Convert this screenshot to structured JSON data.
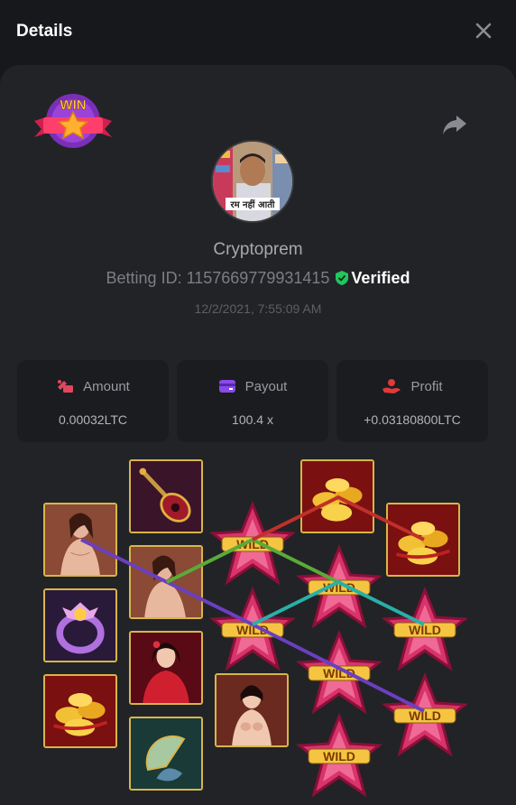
{
  "header": {
    "title": "Details"
  },
  "badge": {
    "text": "WIN"
  },
  "avatar": {
    "caption": "रम नहीं आती"
  },
  "user": {
    "name": "Cryptoprem",
    "betting_prefix": "Betting ID: 1157669779931415",
    "verified_label": "Verified",
    "timestamp": "12/2/2021, 7:55:09 AM"
  },
  "stats": [
    {
      "label": "Amount",
      "value": "0.00032LTC",
      "icon": "amount-icon"
    },
    {
      "label": "Payout",
      "value": "100.4 x",
      "icon": "wallet-icon"
    },
    {
      "label": "Profit",
      "value": "+0.03180800LTC",
      "icon": "profit-icon"
    }
  ],
  "reels": {
    "wild_text": "WILD",
    "symbols": [
      "lady",
      "pipa",
      "gold",
      "ring",
      "lady",
      "wild",
      "wild",
      "gold",
      "gold",
      "lady",
      "wild",
      "wild",
      "wild",
      "fan",
      "lady",
      "wild",
      "wild"
    ],
    "paylines": [
      "purple",
      "green",
      "red",
      "teal"
    ]
  },
  "colors": {
    "background": "#17181b",
    "panel": "#222326",
    "verified": "#22c55e",
    "tile_border": "#d8b54a",
    "line_purple": "#6b3fc0",
    "line_green": "#5aaa3a",
    "line_red": "#c0302a",
    "line_teal": "#28b0a8"
  }
}
